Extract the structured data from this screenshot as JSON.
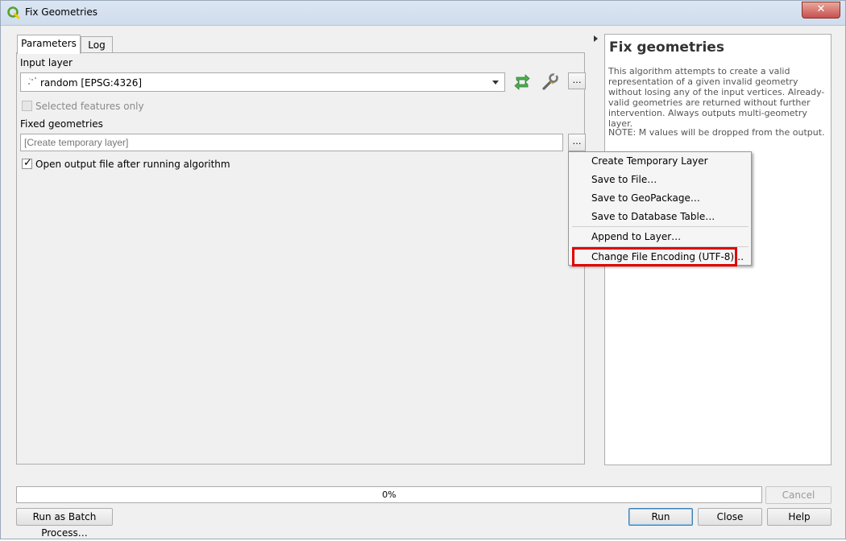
{
  "window": {
    "title": "Fix Geometries",
    "close_label": "✕"
  },
  "tabs": [
    {
      "label": "Parameters",
      "active": true
    },
    {
      "label": "Log",
      "active": false
    }
  ],
  "params": {
    "input_layer_label": "Input layer",
    "input_layer_value": "random [EPSG:4326]",
    "selected_features_label": "Selected features only",
    "fixed_geometries_label": "Fixed geometries",
    "fixed_geometries_placeholder": "[Create temporary layer]",
    "ellipsis_label": "…",
    "open_output_label": "Open output file after running algorithm",
    "open_output_checked": true
  },
  "help": {
    "title": "Fix geometries",
    "description": "This algorithm attempts to create a valid representation of a given invalid geometry without losing any of the input vertices. Already-valid geometries are returned without further intervention. Always outputs multi-geometry layer.",
    "note": "NOTE: M values will be dropped from the output."
  },
  "menu": {
    "items": [
      "Create Temporary Layer",
      "Save to File…",
      "Save to GeoPackage…",
      "Save to Database Table…",
      "Append to Layer…",
      "Change File Encoding (UTF-8)…"
    ]
  },
  "footer": {
    "progress_text": "0%",
    "progress_value": 0,
    "cancel_label": "Cancel",
    "batch_label": "Run as Batch Process…",
    "run_label": "Run",
    "close_label": "Close",
    "help_label": "Help"
  },
  "colors": {
    "highlight": "#e00000",
    "iterate_icon": "#4caf50"
  }
}
